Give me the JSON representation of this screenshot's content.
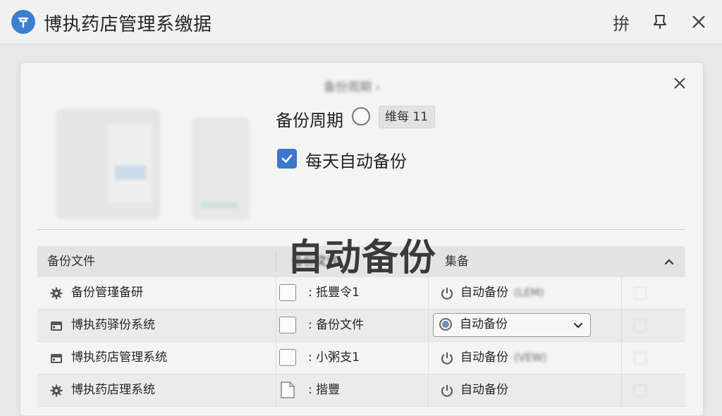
{
  "window": {
    "title": "博执药店管理系缴据",
    "toolbar_glyph": "拚",
    "icons": {
      "logo": "pin-logo-icon",
      "pin": "pin-icon",
      "close": "close-icon"
    }
  },
  "dialog": {
    "heading": "备份周期 ›",
    "cycle": {
      "label": "备份周期",
      "selected_value": "维每 11"
    },
    "daily_backup": {
      "label": "每天自动备份",
      "checked": true
    },
    "overlay_text": "自动备份",
    "table": {
      "headers": [
        "备份文件",
        "备份文件",
        "集备"
      ],
      "rows": [
        {
          "icon": "gear-icon",
          "file": "备份管瑾备研",
          "mid": ": 抵豐令1",
          "backup": "自动备份",
          "suffix": "(LEM)",
          "dropdown": false,
          "file_icon": "checkbox"
        },
        {
          "icon": "window-icon",
          "file": "博执药驿份系统",
          "mid": ": 备份文件",
          "backup": "自动备份",
          "suffix": "",
          "dropdown": true,
          "file_icon": "checkbox"
        },
        {
          "icon": "window-icon",
          "file": "博执药店管理系统",
          "mid": ": 小粥支1",
          "backup": "自动备份",
          "suffix": "(VEW)",
          "dropdown": false,
          "file_icon": "checkbox"
        },
        {
          "icon": "gear-icon",
          "file": "博执药店理系统",
          "mid": ": 揩豐",
          "backup": "自动备份",
          "suffix": "",
          "dropdown": false,
          "file_icon": "document"
        }
      ]
    }
  },
  "colors": {
    "accent": "#3b78c9",
    "logo": "#3d7fd0"
  }
}
